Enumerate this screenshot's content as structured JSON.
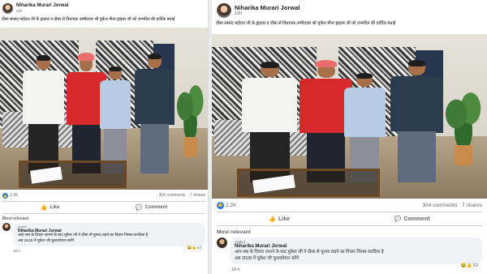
{
  "posts": [
    {
      "author": "Niharika Murari Jorwal",
      "time": "22h",
      "caption": "दौसा सांसद महोदय जी के ड्राइवर व दौसा से विधायक उम्मीदवार श्री मुकेश मीना ड्राइवर जी को जन्मदिन की हार्दिक बधाई",
      "reactions_count": "2.2K",
      "comments_count": "304 comments",
      "shares_count": "7 shares",
      "like_label": "Like",
      "comment_label": "Comment",
      "sort_label": "Most relevant",
      "comment": {
        "badge": "Author",
        "author": "Niharika Murari Jorwal",
        "text_line1": "आप सब के विचार जानने के बाद मुकेश जी ने दौसा से चुनाव लड़ने का विचार निरस्त करदिया है",
        "text_line2": "अब 2028 में मुकेश जी चुनावतैयार करेंगे",
        "reaction": "53",
        "time": "18 h"
      }
    },
    {
      "author": "Niharika Murari Jorwal",
      "time": "22h",
      "caption": "दौसा सांसद महोदय जी के ड्राइवर व दौसा से विधायक उम्मीदवार श्री मुकेश मीना ड्राइवर जी को जन्मदिन की हार्दिक बधाई",
      "reactions_count": "2.2K",
      "comments_count": "304 comments",
      "shares_count": "7 shares",
      "like_label": "Like",
      "comment_label": "Comment",
      "sort_label": "Most relevant",
      "comment": {
        "badge": "Author",
        "author": "Niharika Murari Jorwal",
        "text_line1": "आप सब के विचार जानने के बाद मुकेश जी ने दौसा से चुनाव लड़ने का विचार निरस्त करदिया है",
        "text_line2": "अब 2028 में मुकेश जी चुनावतैयार करेंगे",
        "reaction": "53",
        "time": "18 h"
      }
    }
  ],
  "colors": {
    "accent": "#1877f2",
    "muted": "#65676b",
    "bubble": "#f0f2f5"
  },
  "icons": {
    "like": "thumbs-up-icon",
    "comment": "speech-bubble-icon",
    "reaction": "like-reaction-icon"
  }
}
